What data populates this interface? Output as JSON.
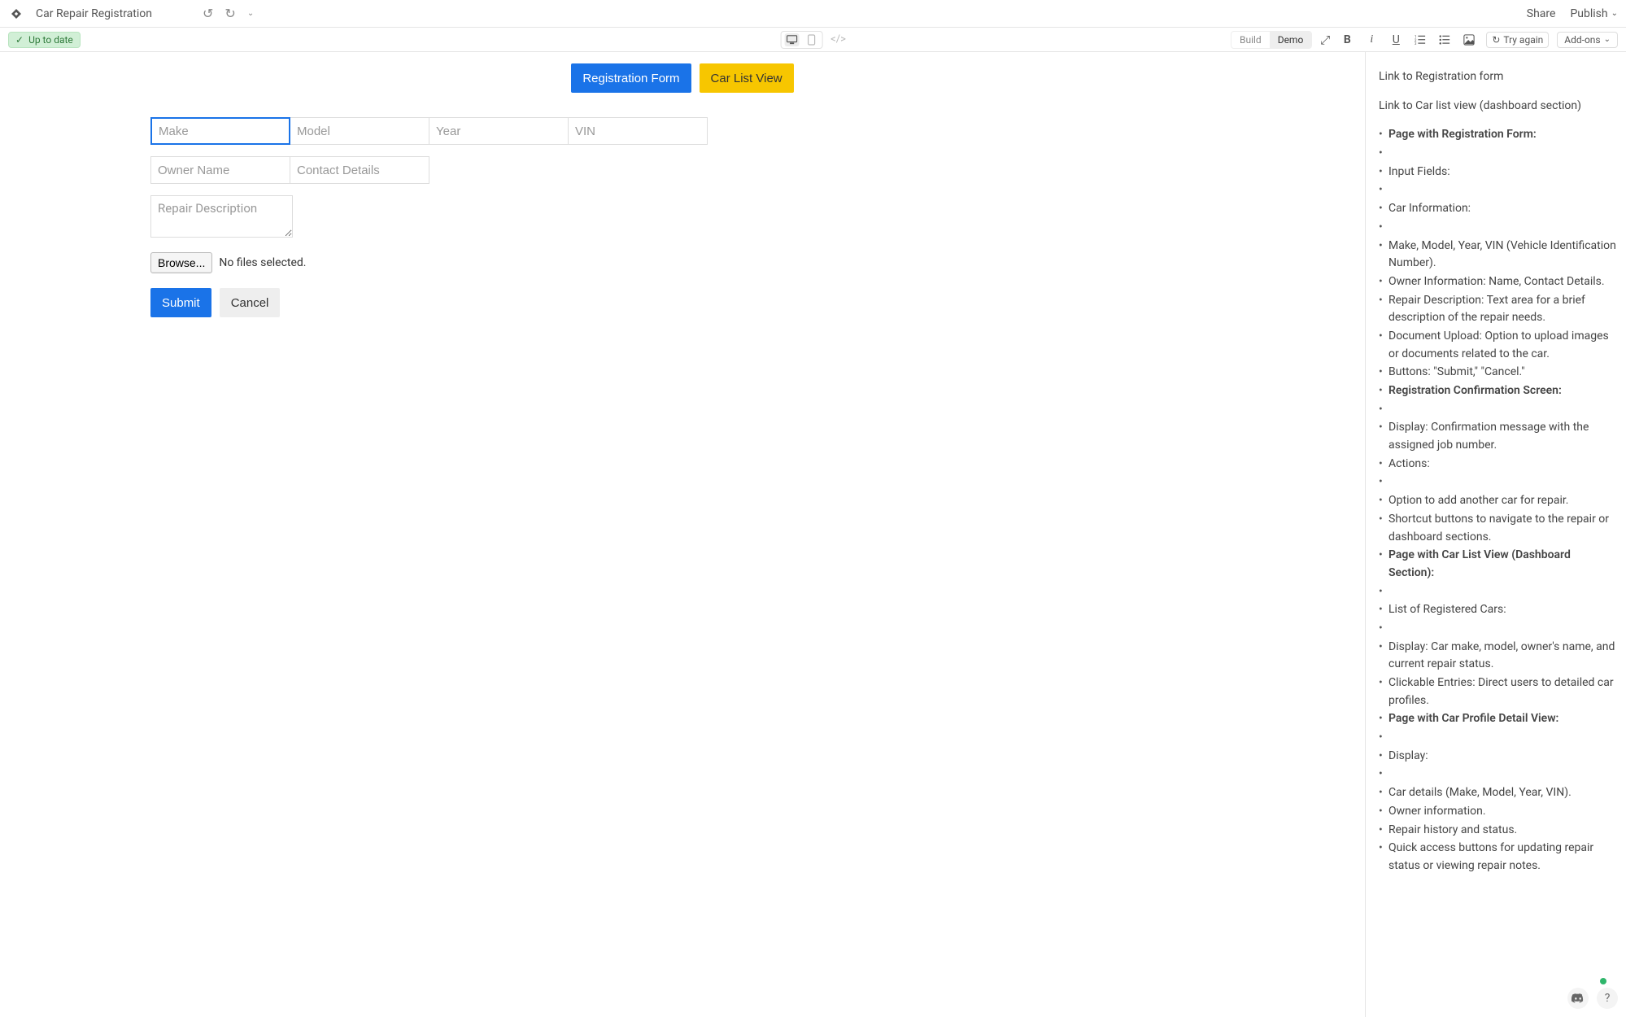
{
  "header": {
    "title": "Car Repair Registration",
    "share": "Share",
    "publish": "Publish"
  },
  "subheader": {
    "status": "Up to date",
    "build": "Build",
    "demo": "Demo",
    "try_again": "Try again",
    "addons": "Add-ons"
  },
  "nav": {
    "registration": "Registration Form",
    "car_list": "Car List View"
  },
  "form": {
    "make_placeholder": "Make",
    "model_placeholder": "Model",
    "year_placeholder": "Year",
    "vin_placeholder": "VIN",
    "owner_placeholder": "Owner Name",
    "contact_placeholder": "Contact Details",
    "repair_placeholder": "Repair Description",
    "browse": "Browse...",
    "file_status": "No files selected.",
    "submit": "Submit",
    "cancel": "Cancel"
  },
  "sidebar": {
    "link1": "Link to Registration form",
    "link2": "Link to Car list view (dashboard section)",
    "items": [
      {
        "text": "Page with Registration Form:",
        "bold": true
      },
      {
        "text": ""
      },
      {
        "text": "Input Fields:"
      },
      {
        "text": ""
      },
      {
        "text": "Car Information:"
      },
      {
        "text": ""
      },
      {
        "text": "Make, Model, Year, VIN (Vehicle Identification Number)."
      },
      {
        "text": "Owner Information: Name, Contact Details."
      },
      {
        "text": "Repair Description: Text area for a brief description of the repair needs."
      },
      {
        "text": "Document Upload: Option to upload images or documents related to the car."
      },
      {
        "text": "Buttons: \"Submit,\" \"Cancel.\""
      },
      {
        "text": "Registration Confirmation Screen:",
        "bold": true
      },
      {
        "text": ""
      },
      {
        "text": "Display: Confirmation message with the assigned job number."
      },
      {
        "text": "Actions:"
      },
      {
        "text": ""
      },
      {
        "text": "Option to add another car for repair."
      },
      {
        "text": "Shortcut buttons to navigate to the repair or dashboard sections."
      },
      {
        "text": "Page with Car List View (Dashboard Section):",
        "bold": true
      },
      {
        "text": ""
      },
      {
        "text": "List of Registered Cars:"
      },
      {
        "text": ""
      },
      {
        "text": "Display: Car make, model, owner's name, and current repair status."
      },
      {
        "text": "Clickable Entries: Direct users to detailed car profiles."
      },
      {
        "text": "Page with Car Profile Detail View:",
        "bold": true
      },
      {
        "text": ""
      },
      {
        "text": "Display:"
      },
      {
        "text": ""
      },
      {
        "text": "Car details (Make, Model, Year, VIN)."
      },
      {
        "text": "Owner information."
      },
      {
        "text": "Repair history and status."
      },
      {
        "text": "Quick access buttons for updating repair status or viewing repair notes."
      }
    ]
  }
}
